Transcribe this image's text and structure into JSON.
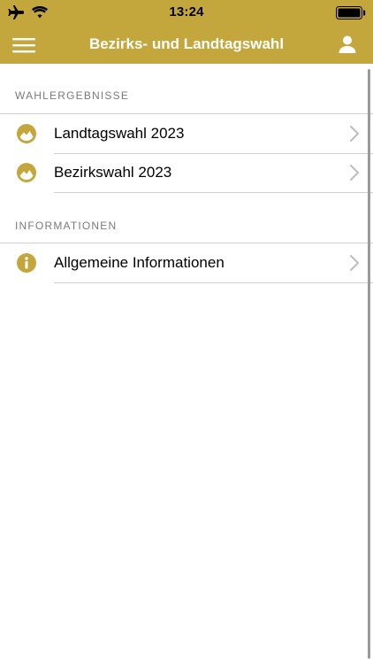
{
  "status": {
    "time": "13:24",
    "icons": [
      "airplane-icon",
      "wifi-icon",
      "battery-icon"
    ]
  },
  "nav": {
    "title": "Bezirks- und Landtagswahl",
    "menu_icon": "hamburger-menu-icon",
    "user_icon": "user-icon"
  },
  "sections": [
    {
      "header": "WAHLERGEBNISSE",
      "items": [
        {
          "label": "Landtagswahl 2023",
          "icon": "chart-circle-icon"
        },
        {
          "label": "Bezirkswahl 2023",
          "icon": "chart-circle-icon"
        }
      ]
    },
    {
      "header": "INFORMATIONEN",
      "items": [
        {
          "label": "Allgemeine Informationen",
          "icon": "info-icon"
        }
      ]
    }
  ],
  "colors": {
    "accent": "#c4a73c",
    "separator": "#cfcfcf",
    "section_text": "#7a7a7a",
    "chevron": "#bdbdbd"
  }
}
